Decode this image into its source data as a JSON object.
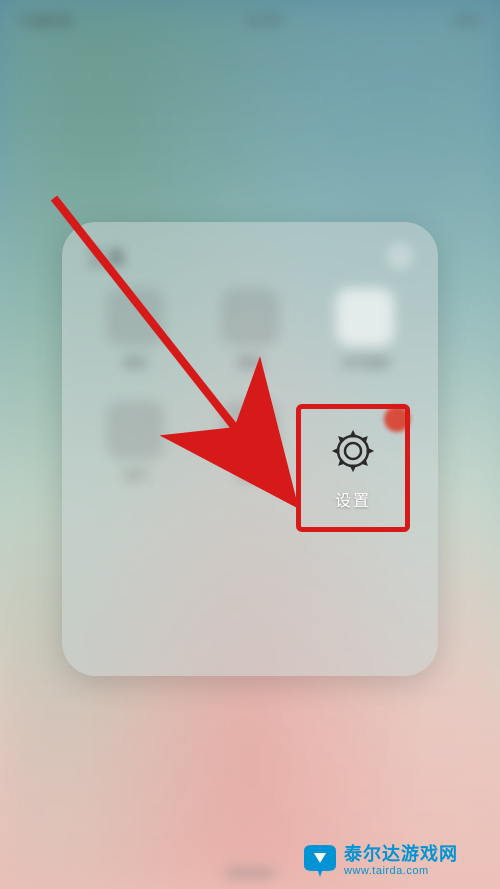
{
  "status": {
    "carrier": "中国联通",
    "time": "15:28",
    "battery": "65%"
  },
  "folder": {
    "title": "工具",
    "apps": [
      {
        "label": "相机"
      },
      {
        "label": "图库"
      },
      {
        "label": "文件管理"
      },
      {
        "label": "天气"
      },
      {
        "label": "时钟"
      }
    ]
  },
  "highlighted": {
    "label": "设置",
    "icon": "gear"
  },
  "watermark": {
    "name": "泰尔达游戏网",
    "url": "www.tairda.com"
  },
  "colors": {
    "highlight": "#d61a1a",
    "brand": "#0094d4",
    "notif": "#d84c3c"
  }
}
